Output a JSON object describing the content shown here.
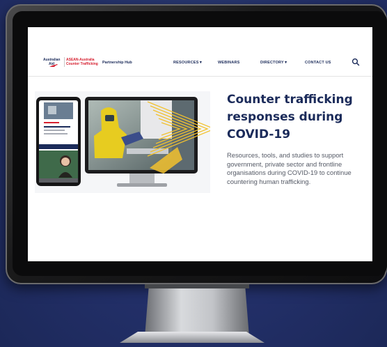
{
  "site": {
    "logo": {
      "donor_line1": "Australian",
      "donor_line2": "Aid",
      "program_line1": "ASEAN-Australia",
      "program_line2": "Counter Trafficking"
    },
    "hub_label": "Partnership Hub"
  },
  "nav": {
    "resources": "RESOURCES▼",
    "webinars": "WEBINARS",
    "directory": "DIRECTORY▼",
    "contact": "CONTACT US",
    "search_icon": "search-icon"
  },
  "hero": {
    "title": "Counter trafficking responses during COVID-19",
    "description": "Resources, tools, and studies to support government, private sector and frontline organisations during COVID-19 to continue countering human trafficking."
  },
  "colors": {
    "navy": "#1b2b5a",
    "brand_red": "#d62030",
    "accent_yellow": "#f2c12e",
    "background": "#23306a"
  }
}
